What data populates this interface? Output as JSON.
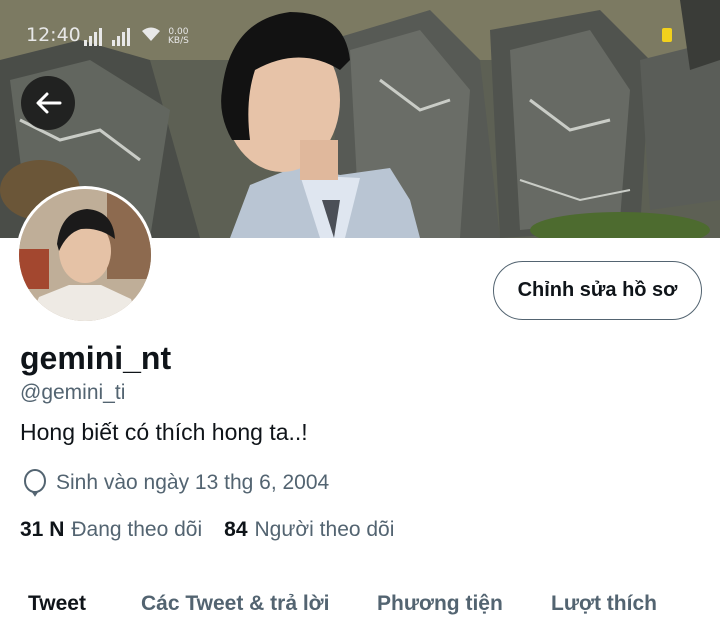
{
  "status_bar": {
    "time": "12:40",
    "net_speed_value": "0.00",
    "net_speed_unit": "KB/S"
  },
  "profile": {
    "display_name": "gemini_nt",
    "handle": "@gemini_ti",
    "bio": "Hong biết có thích hong ta..!",
    "birth_date": "Sinh vào ngày 13 thg 6, 2004",
    "following_count": "31 N",
    "following_label": "Đang theo dõi",
    "followers_count": "84",
    "followers_label": "Người theo dõi"
  },
  "actions": {
    "edit_profile_label": "Chỉnh sửa hồ sơ"
  },
  "tabs": [
    {
      "label": "Tweet",
      "active": true
    },
    {
      "label": "Các Tweet & trả lời",
      "active": false
    },
    {
      "label": "Phương tiện",
      "active": false
    },
    {
      "label": "Lượt thích",
      "active": false
    }
  ],
  "icons": {
    "back": "arrow-left-icon",
    "birth": "balloon-icon"
  }
}
